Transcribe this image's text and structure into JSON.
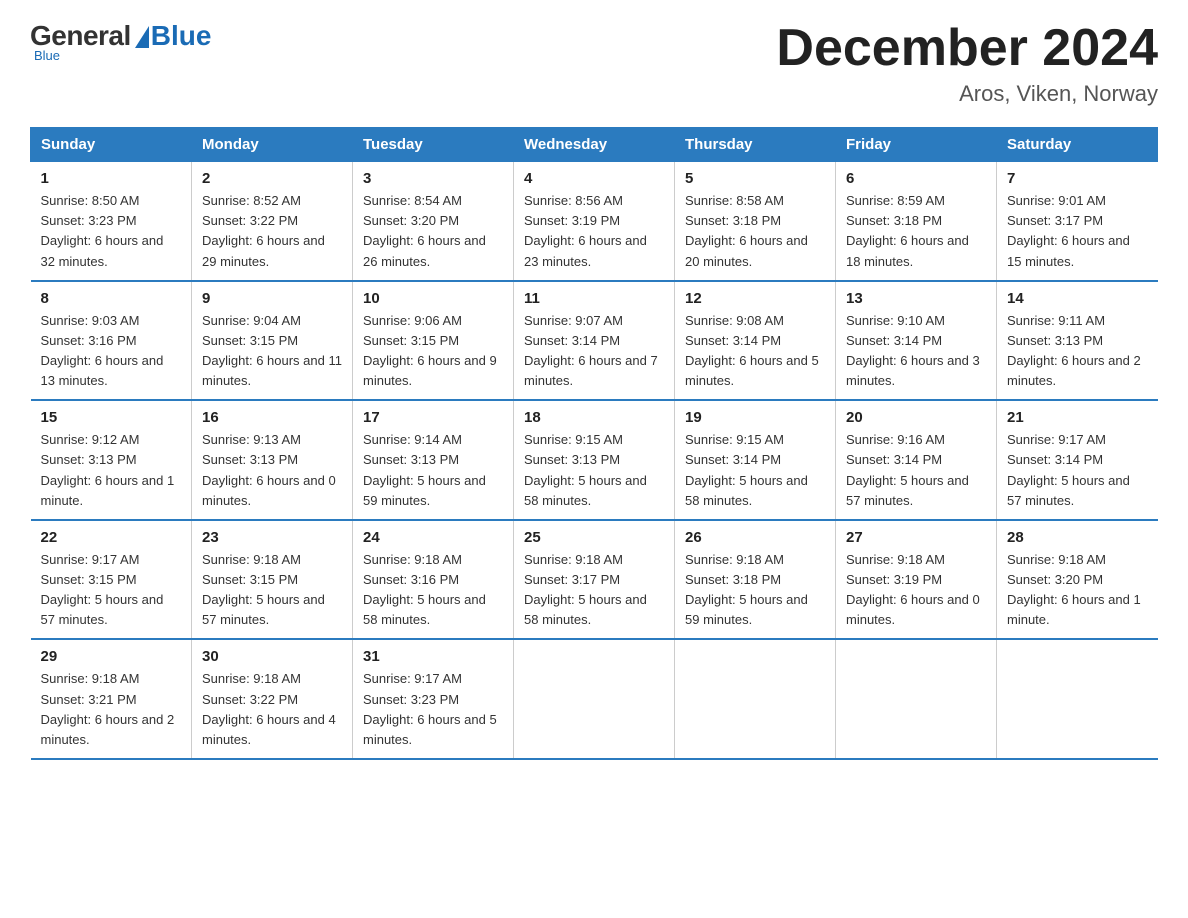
{
  "header": {
    "logo_general": "General",
    "logo_blue": "Blue",
    "month_title": "December 2024",
    "location": "Aros, Viken, Norway"
  },
  "weekdays": [
    "Sunday",
    "Monday",
    "Tuesday",
    "Wednesday",
    "Thursday",
    "Friday",
    "Saturday"
  ],
  "weeks": [
    [
      {
        "day": "1",
        "sunrise": "8:50 AM",
        "sunset": "3:23 PM",
        "daylight": "6 hours and 32 minutes."
      },
      {
        "day": "2",
        "sunrise": "8:52 AM",
        "sunset": "3:22 PM",
        "daylight": "6 hours and 29 minutes."
      },
      {
        "day": "3",
        "sunrise": "8:54 AM",
        "sunset": "3:20 PM",
        "daylight": "6 hours and 26 minutes."
      },
      {
        "day": "4",
        "sunrise": "8:56 AM",
        "sunset": "3:19 PM",
        "daylight": "6 hours and 23 minutes."
      },
      {
        "day": "5",
        "sunrise": "8:58 AM",
        "sunset": "3:18 PM",
        "daylight": "6 hours and 20 minutes."
      },
      {
        "day": "6",
        "sunrise": "8:59 AM",
        "sunset": "3:18 PM",
        "daylight": "6 hours and 18 minutes."
      },
      {
        "day": "7",
        "sunrise": "9:01 AM",
        "sunset": "3:17 PM",
        "daylight": "6 hours and 15 minutes."
      }
    ],
    [
      {
        "day": "8",
        "sunrise": "9:03 AM",
        "sunset": "3:16 PM",
        "daylight": "6 hours and 13 minutes."
      },
      {
        "day": "9",
        "sunrise": "9:04 AM",
        "sunset": "3:15 PM",
        "daylight": "6 hours and 11 minutes."
      },
      {
        "day": "10",
        "sunrise": "9:06 AM",
        "sunset": "3:15 PM",
        "daylight": "6 hours and 9 minutes."
      },
      {
        "day": "11",
        "sunrise": "9:07 AM",
        "sunset": "3:14 PM",
        "daylight": "6 hours and 7 minutes."
      },
      {
        "day": "12",
        "sunrise": "9:08 AM",
        "sunset": "3:14 PM",
        "daylight": "6 hours and 5 minutes."
      },
      {
        "day": "13",
        "sunrise": "9:10 AM",
        "sunset": "3:14 PM",
        "daylight": "6 hours and 3 minutes."
      },
      {
        "day": "14",
        "sunrise": "9:11 AM",
        "sunset": "3:13 PM",
        "daylight": "6 hours and 2 minutes."
      }
    ],
    [
      {
        "day": "15",
        "sunrise": "9:12 AM",
        "sunset": "3:13 PM",
        "daylight": "6 hours and 1 minute."
      },
      {
        "day": "16",
        "sunrise": "9:13 AM",
        "sunset": "3:13 PM",
        "daylight": "6 hours and 0 minutes."
      },
      {
        "day": "17",
        "sunrise": "9:14 AM",
        "sunset": "3:13 PM",
        "daylight": "5 hours and 59 minutes."
      },
      {
        "day": "18",
        "sunrise": "9:15 AM",
        "sunset": "3:13 PM",
        "daylight": "5 hours and 58 minutes."
      },
      {
        "day": "19",
        "sunrise": "9:15 AM",
        "sunset": "3:14 PM",
        "daylight": "5 hours and 58 minutes."
      },
      {
        "day": "20",
        "sunrise": "9:16 AM",
        "sunset": "3:14 PM",
        "daylight": "5 hours and 57 minutes."
      },
      {
        "day": "21",
        "sunrise": "9:17 AM",
        "sunset": "3:14 PM",
        "daylight": "5 hours and 57 minutes."
      }
    ],
    [
      {
        "day": "22",
        "sunrise": "9:17 AM",
        "sunset": "3:15 PM",
        "daylight": "5 hours and 57 minutes."
      },
      {
        "day": "23",
        "sunrise": "9:18 AM",
        "sunset": "3:15 PM",
        "daylight": "5 hours and 57 minutes."
      },
      {
        "day": "24",
        "sunrise": "9:18 AM",
        "sunset": "3:16 PM",
        "daylight": "5 hours and 58 minutes."
      },
      {
        "day": "25",
        "sunrise": "9:18 AM",
        "sunset": "3:17 PM",
        "daylight": "5 hours and 58 minutes."
      },
      {
        "day": "26",
        "sunrise": "9:18 AM",
        "sunset": "3:18 PM",
        "daylight": "5 hours and 59 minutes."
      },
      {
        "day": "27",
        "sunrise": "9:18 AM",
        "sunset": "3:19 PM",
        "daylight": "6 hours and 0 minutes."
      },
      {
        "day": "28",
        "sunrise": "9:18 AM",
        "sunset": "3:20 PM",
        "daylight": "6 hours and 1 minute."
      }
    ],
    [
      {
        "day": "29",
        "sunrise": "9:18 AM",
        "sunset": "3:21 PM",
        "daylight": "6 hours and 2 minutes."
      },
      {
        "day": "30",
        "sunrise": "9:18 AM",
        "sunset": "3:22 PM",
        "daylight": "6 hours and 4 minutes."
      },
      {
        "day": "31",
        "sunrise": "9:17 AM",
        "sunset": "3:23 PM",
        "daylight": "6 hours and 5 minutes."
      },
      null,
      null,
      null,
      null
    ]
  ]
}
